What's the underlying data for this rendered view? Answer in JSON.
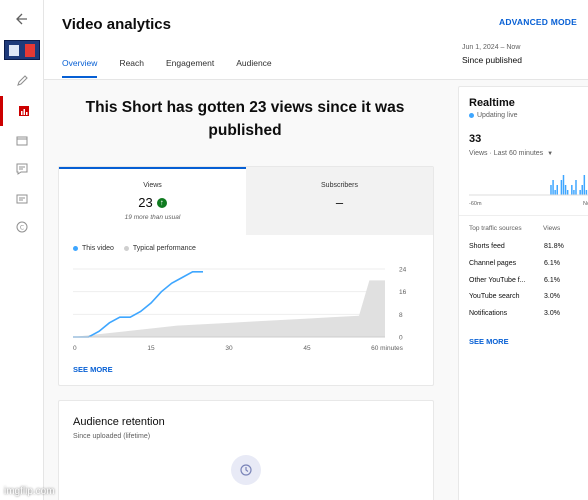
{
  "header": {
    "title": "Video analytics",
    "advanced_mode": "ADVANCED MODE",
    "tabs": [
      "Overview",
      "Reach",
      "Engagement",
      "Audience"
    ],
    "period_range": "Jun 1, 2024 – Now",
    "period_label": "Since published"
  },
  "headline": "This Short has gotten 23 views since it was published",
  "metrics": {
    "views_label": "Views",
    "views_value": "23",
    "views_note": "19 more than usual",
    "subs_label": "Subscribers",
    "subs_value": "–"
  },
  "chart_data": {
    "type": "line",
    "legend": [
      "This video",
      "Typical performance"
    ],
    "x_ticks": [
      "0",
      "15",
      "30",
      "45",
      "60 minutes"
    ],
    "y_ticks": [
      "24",
      "16",
      "8",
      "0"
    ],
    "ylim": [
      0,
      24
    ],
    "xlim": [
      0,
      60
    ],
    "series": [
      {
        "name": "This video",
        "x": [
          0,
          3,
          5,
          7,
          9,
          11,
          13,
          15,
          17,
          19,
          21,
          23,
          25
        ],
        "y": [
          0,
          0,
          2,
          5,
          7,
          7,
          9,
          12,
          16,
          19,
          21,
          23,
          23
        ]
      },
      {
        "name": "Typical performance",
        "x": [
          0,
          5,
          10,
          15,
          20,
          25,
          30,
          35,
          40,
          45,
          50,
          55,
          57,
          60
        ],
        "y": [
          0,
          1,
          2,
          3,
          4,
          4.5,
          5,
          5.5,
          6,
          6.5,
          7,
          7.5,
          20,
          20
        ]
      }
    ],
    "colors": {
      "this_video": "#3ea6ff",
      "typical": "#e0e0e0"
    }
  },
  "see_more": "SEE MORE",
  "retention": {
    "title": "Audience retention",
    "subtitle": "Since uploaded (lifetime)"
  },
  "realtime": {
    "title": "Realtime",
    "updating": "Updating live",
    "count": "33",
    "views_label": "Views · Last 60 minutes",
    "axis_start": "-60m",
    "axis_end": "No",
    "bars": [
      0,
      0,
      0,
      0,
      0,
      0,
      0,
      0,
      0,
      0,
      0,
      0,
      0,
      0,
      0,
      0,
      0,
      0,
      0,
      0,
      0,
      0,
      0,
      0,
      0,
      0,
      0,
      0,
      0,
      0,
      0,
      0,
      0,
      0,
      0,
      0,
      0,
      0,
      0,
      2,
      3,
      1,
      2,
      0,
      3,
      4,
      2,
      1,
      0,
      2,
      1,
      3,
      0,
      1,
      2,
      4,
      1,
      0,
      2,
      1
    ],
    "sources_header": "Top traffic sources",
    "sources_col": "Views",
    "sources": [
      {
        "name": "Shorts feed",
        "pct": "81.8%"
      },
      {
        "name": "Channel pages",
        "pct": "6.1%"
      },
      {
        "name": "Other YouTube f...",
        "pct": "6.1%"
      },
      {
        "name": "YouTube search",
        "pct": "3.0%"
      },
      {
        "name": "Notifications",
        "pct": "3.0%"
      }
    ],
    "see_more": "SEE MORE"
  },
  "watermark": "imgflip.com"
}
